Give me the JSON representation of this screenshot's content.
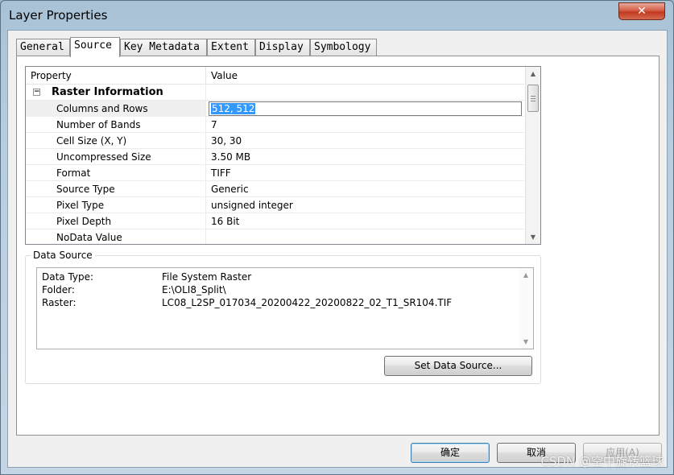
{
  "window": {
    "title": "Layer Properties",
    "close_glyph": "✕"
  },
  "tabs": [
    {
      "label": "General"
    },
    {
      "label": "Source"
    },
    {
      "label": "Key Metadata"
    },
    {
      "label": "Extent"
    },
    {
      "label": "Display"
    },
    {
      "label": "Symbology"
    }
  ],
  "active_tab": "Source",
  "grid": {
    "headers": {
      "property": "Property",
      "value": "Value"
    },
    "group": {
      "label": "Raster Information",
      "expander": "−"
    },
    "rows": [
      {
        "property": "Columns and Rows",
        "value": "512, 512"
      },
      {
        "property": "Number of Bands",
        "value": "7"
      },
      {
        "property": "Cell Size (X, Y)",
        "value": "30, 30"
      },
      {
        "property": "Uncompressed Size",
        "value": "3.50 MB"
      },
      {
        "property": "Format",
        "value": "TIFF"
      },
      {
        "property": "Source Type",
        "value": "Generic"
      },
      {
        "property": "Pixel Type",
        "value": "unsigned integer"
      },
      {
        "property": "Pixel Depth",
        "value": "16 Bit"
      },
      {
        "property": "NoData Value",
        "value": ""
      }
    ]
  },
  "data_source": {
    "label": "Data Source",
    "rows": [
      {
        "key": "Data Type:",
        "value": "File System Raster"
      },
      {
        "key": "Folder:",
        "value": "E:\\OLI8_Split\\"
      },
      {
        "key": "Raster:",
        "value": "LC08_L2SP_017034_20200422_20200822_02_T1_SR104.TIF"
      }
    ],
    "set_button": "Set Data Source..."
  },
  "buttons": {
    "ok": "确定",
    "cancel": "取消",
    "apply": "应用(A)"
  },
  "watermark": "CSDN @空中旋转篮球",
  "icons": {
    "scroll_up": "▲",
    "scroll_down": "▼"
  }
}
